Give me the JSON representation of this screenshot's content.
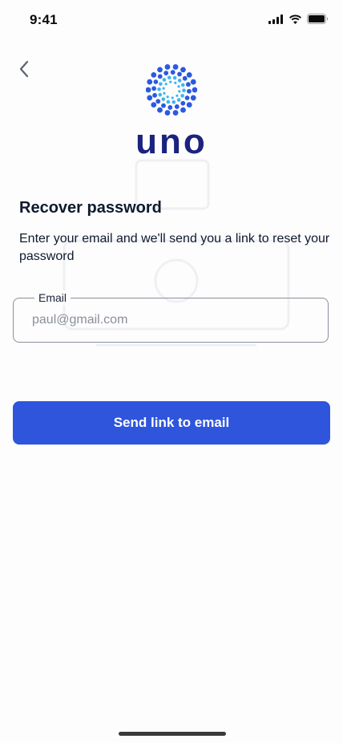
{
  "status_bar": {
    "time": "9:41",
    "icons": [
      "cellular-signal-icon",
      "wifi-icon",
      "battery-icon"
    ]
  },
  "header": {
    "back_icon": "chevron-left-icon",
    "brand": {
      "logo_icon": "dots-burst-logo",
      "wordmark": "uno",
      "colors": {
        "primary": "#1a237e",
        "accent_blue": "#2b59e0",
        "accent_light": "#3fb4f0"
      }
    }
  },
  "main": {
    "title": "Recover password",
    "description": "Enter your email and we'll send you a link to reset your password",
    "email_field": {
      "label": "Email",
      "placeholder": "paul@gmail.com",
      "value": ""
    },
    "send_button": {
      "label": "Send link to email",
      "color": "#2f55dc"
    }
  }
}
